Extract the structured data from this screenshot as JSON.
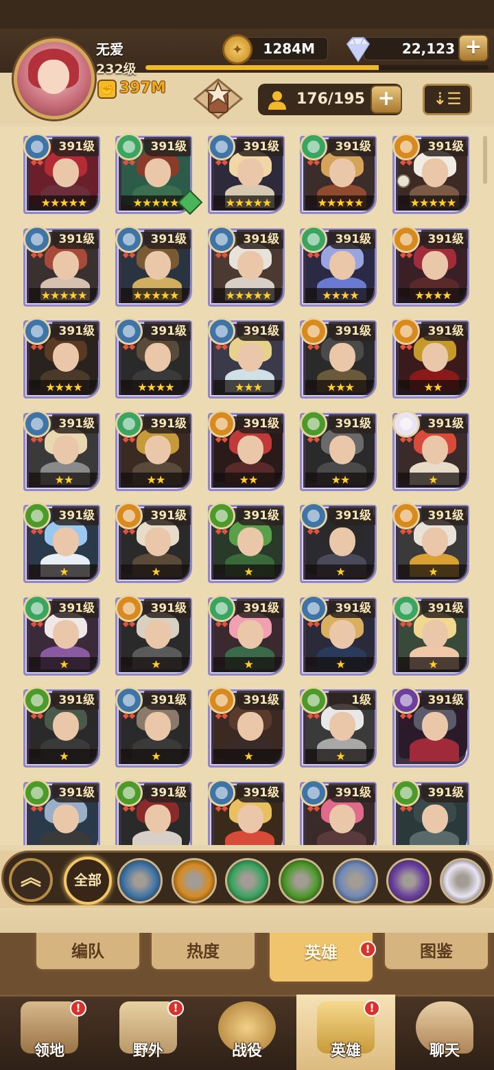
{
  "header": {
    "player_name": "无爱",
    "player_level": "232级",
    "power": "397M",
    "gold": "1284M",
    "gems": "22,123",
    "xp_fraction": 0.68,
    "heroes_count": "176/195"
  },
  "colors": {
    "celestial": "#6f88b8",
    "lightbearer": "#3f74a6",
    "mauler": "#d88a1e",
    "wilder": "#3aa561",
    "graveborn": "#4c9a2a",
    "hypogean": "#e9e4f2",
    "dimensional": "#6a3fa0",
    "gold_star": "#ffcf2e"
  },
  "heroes": [
    {
      "level": "391级",
      "faction": "lightbearer",
      "stars": 5,
      "palette": [
        "#6b1f2a",
        "#b32c35",
        "#6a2f3a"
      ]
    },
    {
      "level": "391级",
      "faction": "wilder",
      "stars": 5,
      "palette": [
        "#2d5b4a",
        "#8a3b2a",
        "#3b6f50"
      ],
      "gem": true
    },
    {
      "level": "391级",
      "faction": "lightbearer",
      "stars": 5,
      "palette": [
        "#2d2a3a",
        "#f0d7a3",
        "#d5c9b3"
      ]
    },
    {
      "level": "391级",
      "faction": "wilder",
      "stars": 5,
      "palette": [
        "#3b2e2a",
        "#d6a35a",
        "#8f4a2f"
      ]
    },
    {
      "level": "391级",
      "faction": "mauler",
      "stars": 5,
      "palette": [
        "#3b2b24",
        "#f0ece4",
        "#7a5a44"
      ],
      "lock": true
    },
    {
      "level": "391级",
      "faction": "lightbearer",
      "stars": 5,
      "palette": [
        "#3a3030",
        "#a74a3a",
        "#d6c0b0"
      ]
    },
    {
      "level": "391级",
      "faction": "lightbearer",
      "stars": 5,
      "palette": [
        "#2a3340",
        "#7a5a32",
        "#d0b060"
      ]
    },
    {
      "level": "391级",
      "faction": "lightbearer",
      "stars": 5,
      "palette": [
        "#4a3a32",
        "#e7e2da",
        "#d8d0c6"
      ]
    },
    {
      "level": "391级",
      "faction": "wilder",
      "stars": 4,
      "palette": [
        "#2a2a44",
        "#9aa4e0",
        "#6a7ad0"
      ]
    },
    {
      "level": "391级",
      "faction": "mauler",
      "stars": 4,
      "palette": [
        "#3b1f26",
        "#a22d3a",
        "#5a2a2a"
      ]
    },
    {
      "level": "391级",
      "faction": "lightbearer",
      "stars": 4,
      "palette": [
        "#2a221c",
        "#5a3a22",
        "#4a3a2a"
      ]
    },
    {
      "level": "391级",
      "faction": "lightbearer",
      "stars": 4,
      "palette": [
        "#2a2a2a",
        "#5a4a3a",
        "#3a3a3a"
      ]
    },
    {
      "level": "391级",
      "faction": "lightbearer",
      "stars": 3,
      "palette": [
        "#3a3a4a",
        "#e8d18a",
        "#cfe0e6"
      ]
    },
    {
      "level": "391级",
      "faction": "mauler",
      "stars": 3,
      "palette": [
        "#2a2a2a",
        "#4a4a4a",
        "#6a5a3a"
      ]
    },
    {
      "level": "391级",
      "faction": "mauler",
      "stars": 2,
      "palette": [
        "#3a1a1a",
        "#c59a2a",
        "#8a1a1a"
      ]
    },
    {
      "level": "391级",
      "faction": "lightbearer",
      "stars": 2,
      "palette": [
        "#3a3a3a",
        "#e8d8b0",
        "#8a8a8a"
      ]
    },
    {
      "level": "391级",
      "faction": "wilder",
      "stars": 2,
      "palette": [
        "#3a2a22",
        "#c59a3a",
        "#5a4a3a"
      ]
    },
    {
      "level": "391级",
      "faction": "mauler",
      "stars": 2,
      "palette": [
        "#2a1a1a",
        "#c03a3a",
        "#5a2a2a"
      ]
    },
    {
      "level": "391级",
      "faction": "graveborn",
      "stars": 2,
      "palette": [
        "#2a2a2a",
        "#6a6a6a",
        "#4a4a4a"
      ]
    },
    {
      "level": "391级",
      "faction": "hypogean",
      "stars": 1,
      "palette": [
        "#3a2a2a",
        "#d84a3a",
        "#e8dcc8"
      ]
    },
    {
      "level": "391级",
      "faction": "graveborn",
      "stars": 1,
      "palette": [
        "#2a3a4a",
        "#9ac8f0",
        "#e8eef6"
      ]
    },
    {
      "level": "391级",
      "faction": "mauler",
      "stars": 1,
      "palette": [
        "#2a2a2a",
        "#e8dcc8",
        "#5a4a3a"
      ]
    },
    {
      "level": "391级",
      "faction": "graveborn",
      "stars": 1,
      "palette": [
        "#2a3a2a",
        "#5aa04a",
        "#3a6a3a"
      ]
    },
    {
      "level": "391级",
      "faction": "lightbearer",
      "stars": 1,
      "palette": [
        "#2a2a30",
        "#2a2a2a",
        "#4a4a5a"
      ]
    },
    {
      "level": "391级",
      "faction": "mauler",
      "stars": 1,
      "palette": [
        "#3a3a3a",
        "#e8e2d8",
        "#d8a030"
      ]
    },
    {
      "level": "391级",
      "faction": "wilder",
      "stars": 1,
      "palette": [
        "#3a2a3a",
        "#f0e8e8",
        "#8a5aa0"
      ]
    },
    {
      "level": "391级",
      "faction": "mauler",
      "stars": 1,
      "palette": [
        "#2a2a2a",
        "#d8d0c0",
        "#5a5a5a"
      ]
    },
    {
      "level": "391级",
      "faction": "wilder",
      "stars": 1,
      "palette": [
        "#3a2a30",
        "#f0a0b0",
        "#3a6a4a"
      ]
    },
    {
      "level": "391级",
      "faction": "lightbearer",
      "stars": 1,
      "palette": [
        "#2a2a3a",
        "#d8b060",
        "#2a3a5a"
      ]
    },
    {
      "level": "391级",
      "faction": "wilder",
      "stars": 1,
      "palette": [
        "#3a4a3a",
        "#f0d890",
        "#f0c8a8"
      ]
    },
    {
      "level": "391级",
      "faction": "graveborn",
      "stars": 1,
      "palette": [
        "#2a2a2a",
        "#4a5a4a",
        "#3a3a3a"
      ]
    },
    {
      "level": "391级",
      "faction": "lightbearer",
      "stars": 1,
      "palette": [
        "#2a2a2a",
        "#8a7a6a",
        "#3a3a3a"
      ]
    },
    {
      "level": "391级",
      "faction": "mauler",
      "stars": 1,
      "palette": [
        "#3a2a22",
        "#5a3a2a",
        "#3a2a2a"
      ]
    },
    {
      "level": "1级",
      "faction": "graveborn",
      "stars": 1,
      "palette": [
        "#3a3a3a",
        "#e8e8e8",
        "#a8a8a8"
      ]
    },
    {
      "level": "391级",
      "faction": "dimensional",
      "stars": 0,
      "palette": [
        "#2a1a2a",
        "#5a5a6a",
        "#a02a3a"
      ]
    },
    {
      "level": "391级",
      "faction": "graveborn",
      "stars": 0,
      "palette": [
        "#2a3a4a",
        "#9ab0c8",
        "#3a3a3a"
      ]
    },
    {
      "level": "391级",
      "faction": "graveborn",
      "stars": 0,
      "palette": [
        "#2a2a2a",
        "#8a2a2a",
        "#d8d0c8"
      ]
    },
    {
      "level": "391级",
      "faction": "lightbearer",
      "stars": 0,
      "palette": [
        "#3a2a1a",
        "#e8c060",
        "#d84a3a"
      ]
    },
    {
      "level": "391级",
      "faction": "lightbearer",
      "stars": 0,
      "palette": [
        "#3a2a2a",
        "#e06a8a",
        "#5a3a3a"
      ]
    },
    {
      "level": "391级",
      "faction": "graveborn",
      "stars": 0,
      "palette": [
        "#2a3a3a",
        "#3a4a4a",
        "#5a6a6a"
      ]
    }
  ],
  "filters": {
    "all_label": "全部",
    "factions": [
      "lightbearer",
      "mauler",
      "wilder",
      "graveborn",
      "celestial",
      "dimensional",
      "hypogean"
    ]
  },
  "subtabs": {
    "formation": "编队",
    "hotness": "热度",
    "heroes": "英雄",
    "codex": "图鉴"
  },
  "nav": {
    "territory": "领地",
    "wild": "野外",
    "campaign": "战役",
    "heroes": "英雄",
    "chat": "聊天"
  }
}
